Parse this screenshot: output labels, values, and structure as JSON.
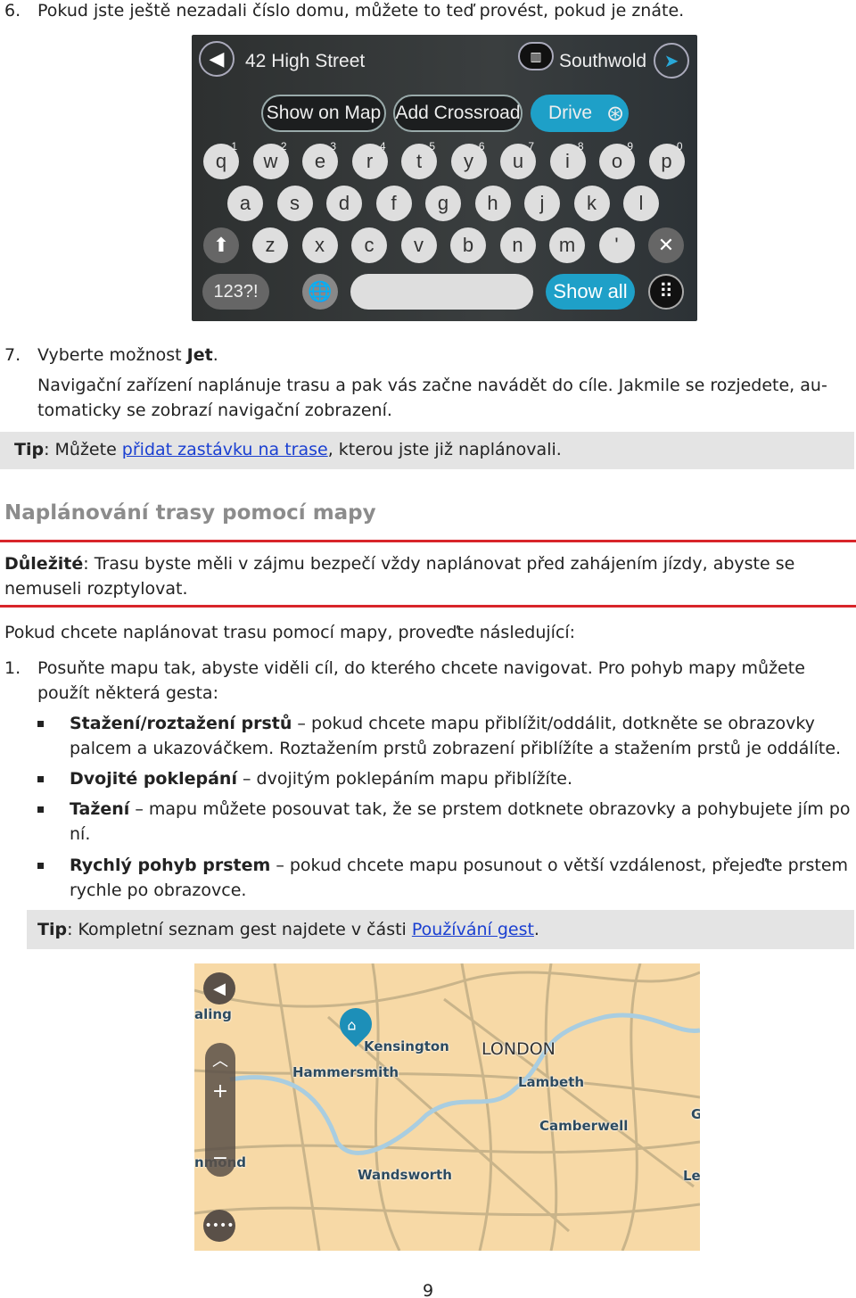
{
  "step6": {
    "num": "6.",
    "text": "Pokud jste ještě nezadali číslo domu, můžete to teď provést, pokud je znáte."
  },
  "keyboard": {
    "address": "42 High Street",
    "city": "Southwold",
    "show_on_map": "Show on Map",
    "add_crossroad": "Add Crossroad",
    "drive": "Drive",
    "row1": [
      [
        "q",
        "1"
      ],
      [
        "w",
        "2"
      ],
      [
        "e",
        "3"
      ],
      [
        "r",
        "4"
      ],
      [
        "t",
        "5"
      ],
      [
        "y",
        "6"
      ],
      [
        "u",
        "7"
      ],
      [
        "i",
        "8"
      ],
      [
        "o",
        "9"
      ],
      [
        "p",
        "0"
      ]
    ],
    "row2": [
      "a",
      "s",
      "d",
      "f",
      "g",
      "h",
      "j",
      "k",
      "l"
    ],
    "row3": [
      "z",
      "x",
      "c",
      "v",
      "b",
      "n",
      "m",
      "'"
    ],
    "num_key": "123?!",
    "show_all": "Show all",
    "accent": "#1ea0c8"
  },
  "step7": {
    "num": "7.",
    "pre": "Vyberte možnost ",
    "bold": "Jet",
    "post": ".",
    "line1": "Navigační zařízení naplánuje trasu a pak vás začne navádět do cíle. Jakmile se rozjedete, au-",
    "line2": "tomaticky se zobrazí navigační zobrazení."
  },
  "tip1": {
    "label": "Tip",
    "pre": ": Můžete ",
    "link": "přidat zastávku na trase",
    "post": ", kterou jste již naplánovali."
  },
  "heading": "Naplánování trasy pomocí mapy",
  "important": {
    "label": "Důležité",
    "line1": ": Trasu byste měli v  zájmu bezpečí vždy naplánovat před zahájením jízdy, abyste se",
    "line2": "nemuseli rozptylovat."
  },
  "intro": "Pokud chcete naplánovat trasu pomocí mapy, proveďte následující:",
  "step1": {
    "num": "1.",
    "line1": "Posuňte mapu tak, abyste viděli cíl, do kterého chcete navigovat. Pro pohyb mapy můžete",
    "line2": "použít některá gesta:"
  },
  "bullets": [
    {
      "bold": "Stažení/roztažení prstů",
      "line1": " – pokud chcete mapu přiblížit/oddálit, dotkněte se obrazovky",
      "line2": "palcem a ukazováčkem. Roztažením prstů zobrazení přiblížíte a stažením prstů je oddálíte."
    },
    {
      "bold": "Dvojité poklepání",
      "line1": " – dvojitým poklepáním mapu přiblížíte.",
      "line2": ""
    },
    {
      "bold": "Tažení",
      "line1": " – mapu můžete posouvat tak, že se prstem dotknete obrazovky a pohybujete jím po",
      "line2": "ní."
    },
    {
      "bold": "Rychlý pohyb prstem",
      "line1": " – pokud chcete mapu posunout o  větší vzdálenost, přejeďte prstem",
      "line2": "rychle po obrazovce."
    }
  ],
  "tip2": {
    "label": "Tip",
    "pre": ": Kompletní seznam gest najdete v  části ",
    "link": "Používání gest",
    "post": "."
  },
  "map": {
    "labels": [
      "aling",
      "Kensington",
      "LONDON",
      "Hammersmith",
      "Lambeth",
      "Camberwell",
      "Wandsworth",
      "nmond",
      "G",
      "Le"
    ]
  },
  "page_number": "9",
  "colors": {
    "red_rule": "#d8252a",
    "link": "#1a3fd1",
    "tip_bg": "#e4e4e4",
    "heading": "#8c8c8c"
  }
}
